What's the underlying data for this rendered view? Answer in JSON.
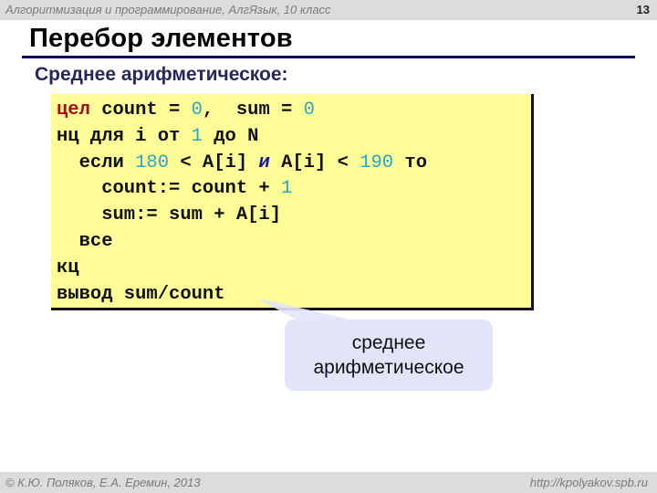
{
  "header": {
    "course": "Алгоритмизация и программирование, АлгЯзык, 10 класс",
    "page_number": "13"
  },
  "slide": {
    "title": "Перебор элементов",
    "subtitle": "Среднее арифметическое:"
  },
  "code": {
    "lines": [
      [
        {
          "t": "цел",
          "c": "kw-red"
        },
        {
          "t": " count = "
        },
        {
          "t": "0",
          "c": "num"
        },
        {
          "t": ",  sum = "
        },
        {
          "t": "0",
          "c": "num"
        }
      ],
      [
        {
          "t": "нц для i от "
        },
        {
          "t": "1",
          "c": "num"
        },
        {
          "t": " до N"
        }
      ],
      [
        {
          "t": "  если "
        },
        {
          "t": "180",
          "c": "num"
        },
        {
          "t": " < A[i] "
        },
        {
          "t": "и",
          "c": "kw-blue"
        },
        {
          "t": " A[i] < "
        },
        {
          "t": "190",
          "c": "num"
        },
        {
          "t": " то"
        }
      ],
      [
        {
          "t": "    count:= count + "
        },
        {
          "t": "1",
          "c": "num"
        }
      ],
      [
        {
          "t": "    sum:= sum + A[i]"
        }
      ],
      [
        {
          "t": "  все"
        }
      ],
      [
        {
          "t": "кц"
        }
      ],
      [
        {
          "t": "вывод sum/count"
        }
      ]
    ]
  },
  "callout": {
    "line1": "среднее",
    "line2": "арифметическое"
  },
  "footer": {
    "copyright": "© К.Ю. Поляков, Е.А. Еремин, 2013",
    "url": "http://kpolyakov.spb.ru"
  },
  "colors": {
    "code_background": "#fefd98",
    "number": "#2aa5c8",
    "keyword_red": "#a01010",
    "keyword_blue": "#1a1aa0",
    "title_rule": "#0a0a5a",
    "callout_background": "#e2e4fa"
  }
}
